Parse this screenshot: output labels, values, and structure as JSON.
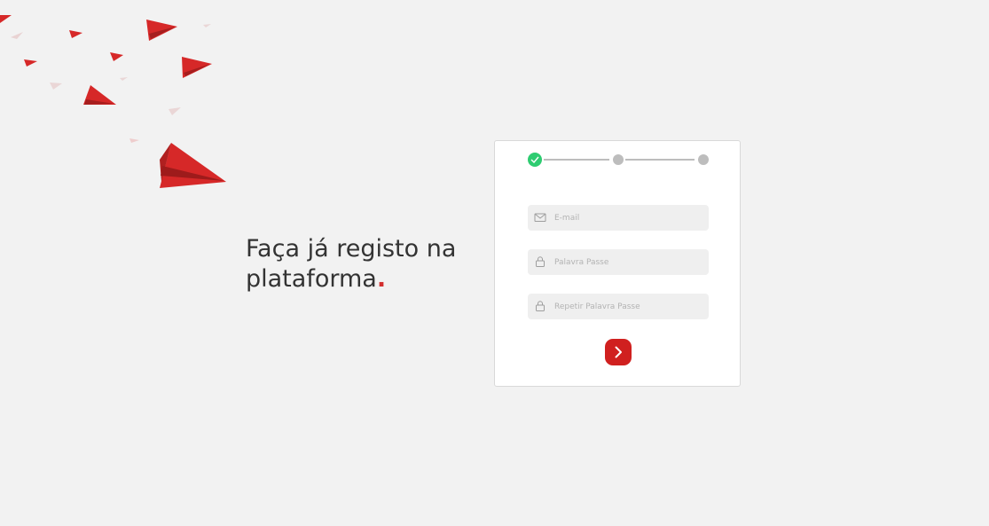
{
  "headline": {
    "text": "Faça já registo na plataforma",
    "dot": "."
  },
  "stepper": {
    "steps": [
      {
        "state": "completed",
        "icon": "check-icon"
      },
      {
        "state": "pending"
      },
      {
        "state": "pending"
      }
    ],
    "current_step": 1,
    "total_steps": 3
  },
  "form": {
    "email": {
      "placeholder": "E-mail",
      "value": "",
      "icon": "envelope-icon"
    },
    "password": {
      "placeholder": "Palavra Passe",
      "value": "",
      "icon": "lock-icon"
    },
    "repeat_password": {
      "placeholder": "Repetir Palavra Passe",
      "value": "",
      "icon": "lock-icon"
    },
    "submit": {
      "icon": "chevron-right-icon"
    }
  },
  "colors": {
    "background": "#f2f2f2",
    "accent": "#d0201f",
    "success": "#2ecc71",
    "step_inactive": "#bdbdbd",
    "text": "#333333",
    "input_background": "#efefef"
  }
}
